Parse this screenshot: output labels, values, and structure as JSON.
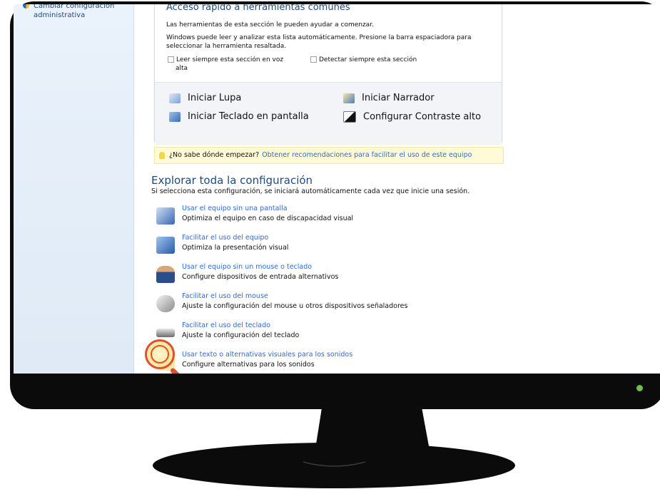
{
  "left_pane": {
    "item_label_line1": "Cambiar configuración",
    "item_label_line2": "administrativa"
  },
  "quick_access": {
    "heading": "Acceso rápido a herramientas comunes",
    "line1": "Las herramientas de esta sección le pueden ayudar a comenzar.",
    "line2a": "Windows puede leer y analizar esta lista automáticamente. Presione la barra espaciadora para",
    "line2b": "seleccionar la herramienta resaltada.",
    "check1_line1": "Leer siempre esta sección en voz",
    "check1_line2": "alta",
    "check2": "Detectar siempre esta sección",
    "tools": {
      "lupa": "Iniciar Lupa",
      "narrador": "Iniciar Narrador",
      "teclado": "Iniciar Teclado en pantalla",
      "contraste": "Configurar Contraste alto"
    }
  },
  "tip": {
    "question": "¿No sabe dónde empezar?",
    "link": "Obtener recomendaciones para facilitar el uso de este equipo"
  },
  "explore": {
    "title": "Explorar toda la configuración",
    "description": "Si selecciona esta configuración, se iniciará automáticamente cada vez que inicie una sesión.",
    "entries": [
      {
        "link": "Usar el equipo sin una pantalla",
        "desc": "Optimiza el equipo en caso de discapacidad visual",
        "icon": "monitor-icon"
      },
      {
        "link": "Facilitar el uso del equipo",
        "desc": "Optimiza la presentación visual",
        "icon": "display-icon"
      },
      {
        "link": "Usar el equipo sin un mouse o teclado",
        "desc": "Configure dispositivos de entrada alternativos",
        "icon": "person-icon"
      },
      {
        "link": "Facilitar el uso del mouse",
        "desc": "Ajuste la configuración del mouse u otros dispositivos señaladores",
        "icon": "mouse-icon"
      },
      {
        "link": "Facilitar el uso del teclado",
        "desc": "Ajuste la configuración del teclado",
        "icon": "keyboard-icon"
      },
      {
        "link": "Usar texto o alternativas visuales para los sonidos",
        "desc": "Configure alternativas para los sonidos",
        "icon": "speech-bubble-icon"
      }
    ]
  },
  "colors": {
    "link": "#2f6ad8",
    "heading": "#1e4a82",
    "magnifier": "#e0502c",
    "power_led": "#6fc04a"
  }
}
